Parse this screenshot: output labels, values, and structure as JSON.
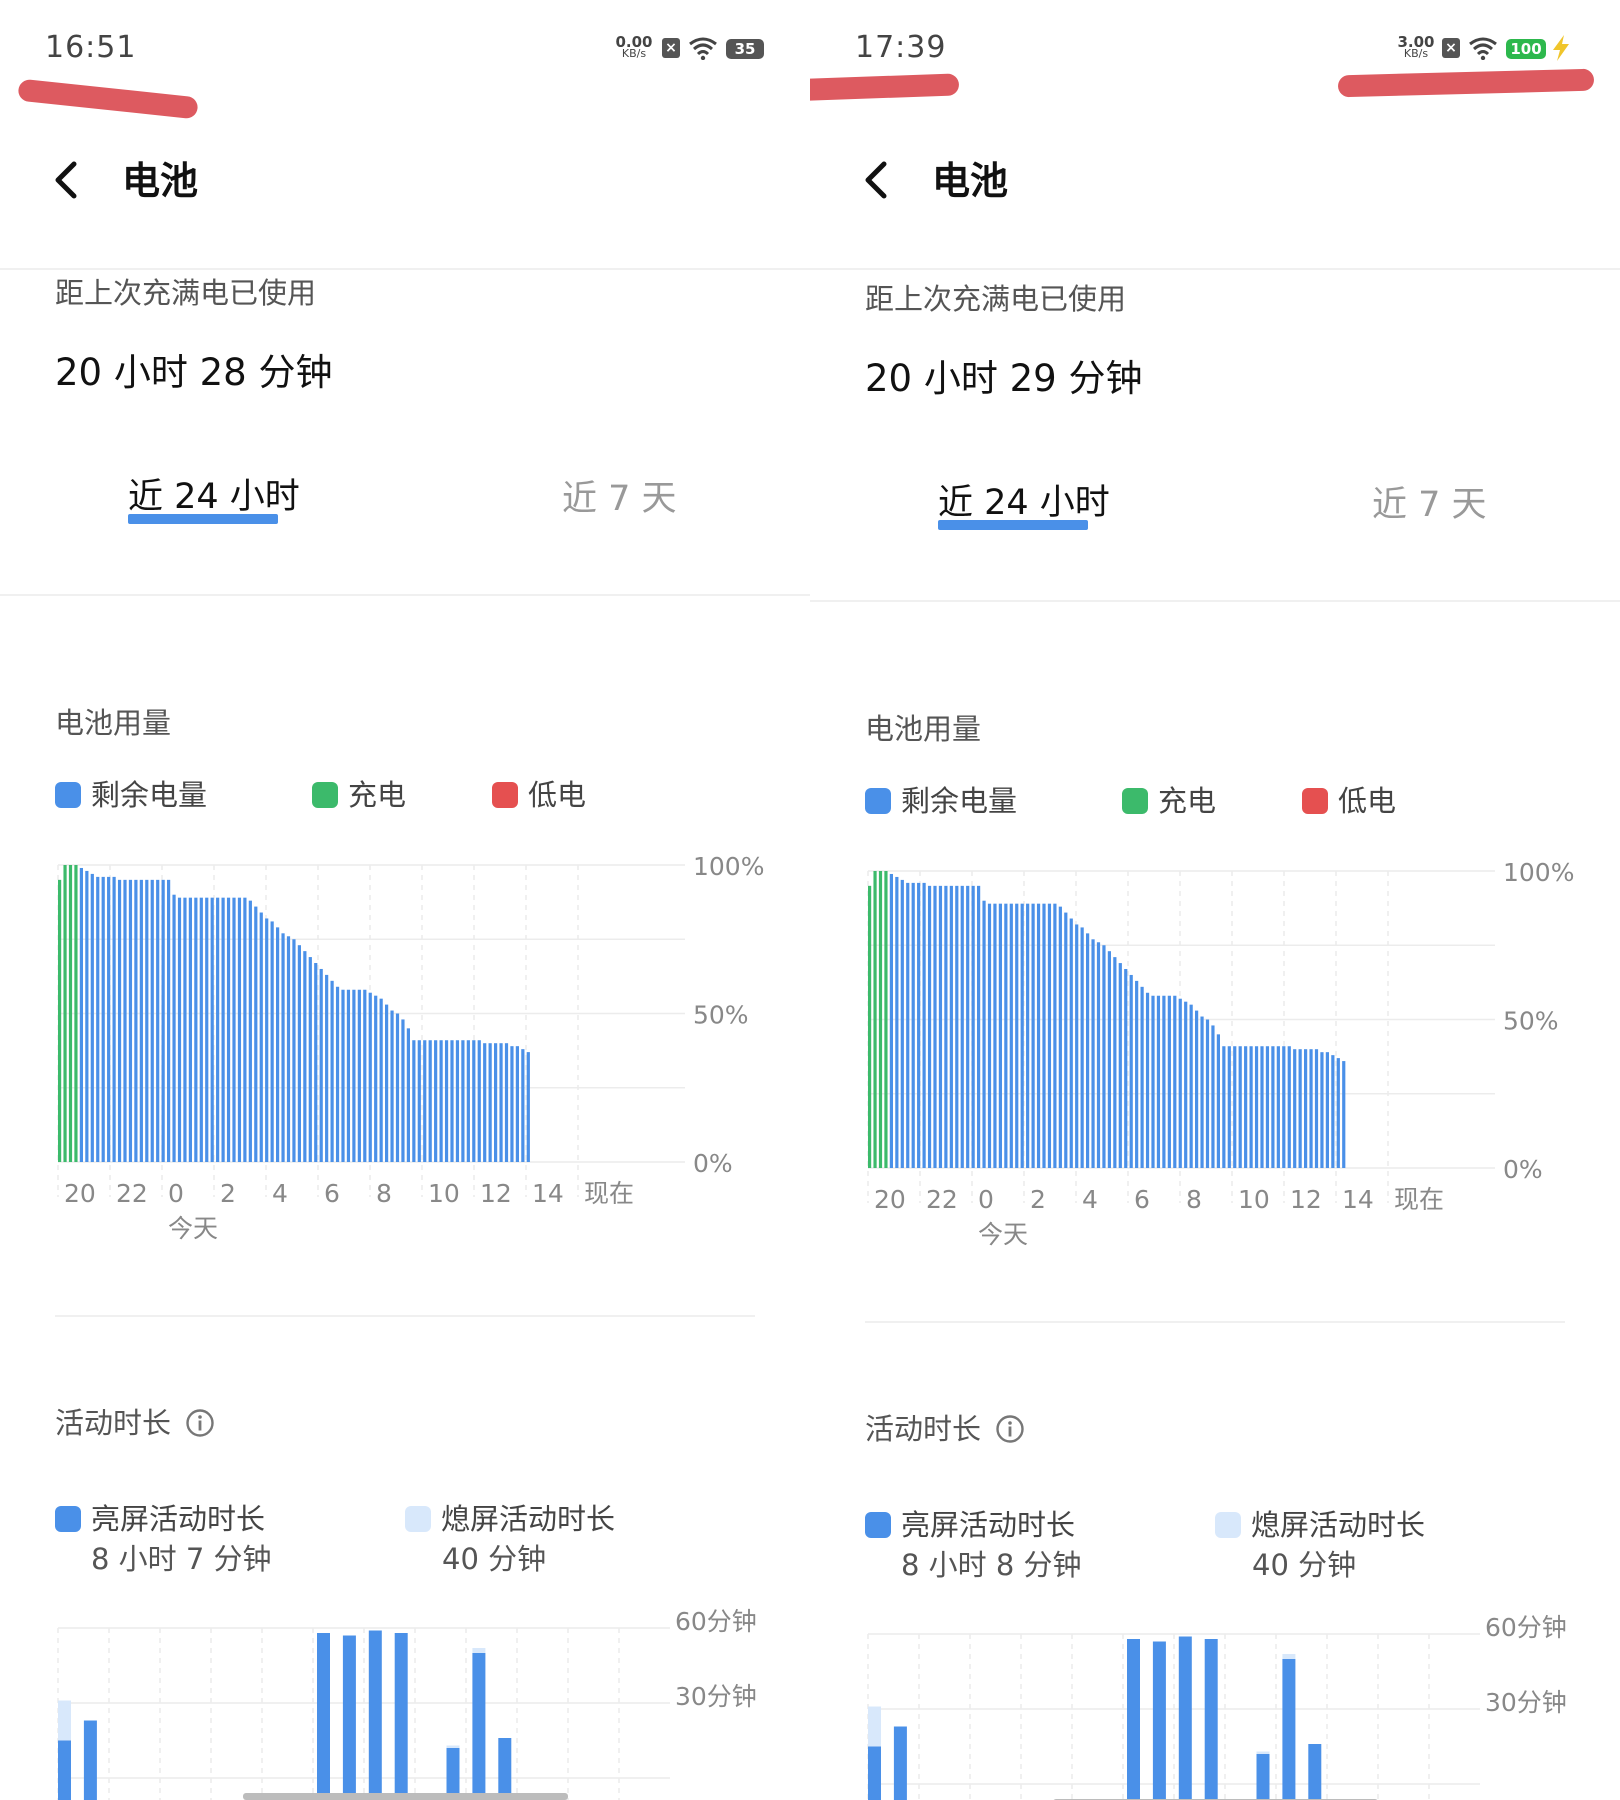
{
  "screens": [
    {
      "status": {
        "time": "16:51",
        "net_speed": "0.00",
        "net_unit": "KB/s",
        "battery": "35",
        "charging": false
      },
      "header": {
        "title": "电池"
      },
      "since_full": {
        "label": "距上次充满电已使用",
        "value": "20 小时 28 分钟"
      },
      "tabs": [
        {
          "label": "近 24 小时",
          "active": true
        },
        {
          "label": "近 7 天",
          "active": false
        }
      ],
      "usage": {
        "title": "电池用量",
        "legend": [
          {
            "label": "剩余电量",
            "color": "#4a90e8"
          },
          {
            "label": "充电",
            "color": "#3cba6b"
          },
          {
            "label": "低电",
            "color": "#e55050"
          }
        ]
      },
      "activity": {
        "title": "活动时长",
        "screen_on": {
          "label": "亮屏活动时长",
          "value": "8 小时 7 分钟",
          "color": "#4a90e8"
        },
        "screen_off": {
          "label": "熄屏活动时长",
          "value": "40 分钟",
          "color": "#d8e8fb"
        }
      }
    },
    {
      "status": {
        "time": "17:39",
        "net_speed": "3.00",
        "net_unit": "KB/s",
        "battery": "100",
        "charging": true
      },
      "header": {
        "title": "电池"
      },
      "since_full": {
        "label": "距上次充满电已使用",
        "value": "20 小时 29 分钟"
      },
      "tabs": [
        {
          "label": "近 24 小时",
          "active": true
        },
        {
          "label": "近 7 天",
          "active": false
        }
      ],
      "usage": {
        "title": "电池用量",
        "legend": [
          {
            "label": "剩余电量",
            "color": "#4a90e8"
          },
          {
            "label": "充电",
            "color": "#3cba6b"
          },
          {
            "label": "低电",
            "color": "#e55050"
          }
        ]
      },
      "activity": {
        "title": "活动时长",
        "screen_on": {
          "label": "亮屏活动时长",
          "value": "8 小时 8 分钟",
          "color": "#4a90e8"
        },
        "screen_off": {
          "label": "熄屏活动时长",
          "value": "40 分钟",
          "color": "#d8e8fb"
        }
      }
    }
  ],
  "chart_data": [
    {
      "type": "bar",
      "panel": 0,
      "ylim": [
        0,
        100
      ],
      "y_ticks": [
        "100%",
        "50%",
        "0%"
      ],
      "x_ticks": [
        "20",
        "22",
        "0",
        "2",
        "4",
        "6",
        "8",
        "10",
        "12",
        "14",
        "现在"
      ],
      "x_sublabel": "今天",
      "charging_bars": 4,
      "values": [
        95,
        100,
        100,
        100,
        99,
        98,
        97,
        96,
        96,
        96,
        96,
        95,
        95,
        95,
        95,
        95,
        95,
        95,
        95,
        95,
        95,
        90,
        89,
        89,
        89,
        89,
        89,
        89,
        89,
        89,
        89,
        89,
        89,
        89,
        89,
        88,
        86,
        84,
        82,
        81,
        79,
        77,
        76,
        75,
        73,
        71,
        69,
        67,
        65,
        63,
        61,
        59,
        58,
        58,
        58,
        58,
        58,
        57,
        56,
        55,
        53,
        51,
        50,
        48,
        45,
        41,
        41,
        41,
        41,
        41,
        41,
        41,
        41,
        41,
        41,
        41,
        41,
        41,
        40,
        40,
        40,
        40,
        40,
        39,
        39,
        38,
        37
      ],
      "xlabel": "",
      "ylabel": ""
    },
    {
      "type": "bar",
      "panel": 1,
      "ylim": [
        0,
        100
      ],
      "y_ticks": [
        "100%",
        "50%",
        "0%"
      ],
      "x_ticks": [
        "20",
        "22",
        "0",
        "2",
        "4",
        "6",
        "8",
        "10",
        "12",
        "14",
        "现在"
      ],
      "x_sublabel": "今天",
      "charging_bars": 4,
      "values": [
        95,
        100,
        100,
        100,
        99,
        98,
        97,
        96,
        96,
        96,
        96,
        95,
        95,
        95,
        95,
        95,
        95,
        95,
        95,
        95,
        95,
        90,
        89,
        89,
        89,
        89,
        89,
        89,
        89,
        89,
        89,
        89,
        89,
        89,
        89,
        88,
        86,
        84,
        82,
        81,
        79,
        77,
        76,
        75,
        73,
        71,
        69,
        67,
        65,
        63,
        61,
        59,
        58,
        58,
        58,
        58,
        58,
        57,
        56,
        55,
        53,
        51,
        50,
        48,
        45,
        41,
        41,
        41,
        41,
        41,
        41,
        41,
        41,
        41,
        41,
        41,
        41,
        41,
        40,
        40,
        40,
        40,
        40,
        39,
        39,
        38,
        37,
        36
      ],
      "xlabel": "",
      "ylabel": ""
    },
    {
      "type": "bar",
      "panel": 0,
      "stacked": true,
      "y_ticks": [
        "60分钟",
        "30分钟"
      ],
      "series": [
        {
          "name": "亮屏活动时长",
          "values": [
            15,
            23,
            0,
            0,
            0,
            0,
            0,
            0,
            0,
            0,
            58,
            57,
            59,
            58,
            0,
            12,
            50,
            16,
            0,
            0,
            0,
            0
          ]
        },
        {
          "name": "熄屏活动时长",
          "values": [
            16,
            0,
            0,
            0,
            0,
            0,
            0,
            0,
            0,
            0,
            0,
            0,
            0,
            0,
            0,
            1,
            2,
            0,
            0,
            0,
            0,
            0
          ]
        }
      ],
      "xlabel": "",
      "ylabel": ""
    },
    {
      "type": "bar",
      "panel": 1,
      "stacked": true,
      "y_ticks": [
        "60分钟",
        "30分钟"
      ],
      "series": [
        {
          "name": "亮屏活动时长",
          "values": [
            15,
            23,
            0,
            0,
            0,
            0,
            0,
            0,
            0,
            0,
            58,
            57,
            59,
            58,
            0,
            12,
            50,
            16,
            0,
            0,
            0,
            0
          ]
        },
        {
          "name": "熄屏活动时长",
          "values": [
            16,
            0,
            0,
            0,
            0,
            0,
            0,
            0,
            0,
            0,
            0,
            0,
            0,
            0,
            0,
            1,
            2,
            0,
            0,
            0,
            0,
            0
          ]
        }
      ],
      "xlabel": "",
      "ylabel": ""
    }
  ]
}
